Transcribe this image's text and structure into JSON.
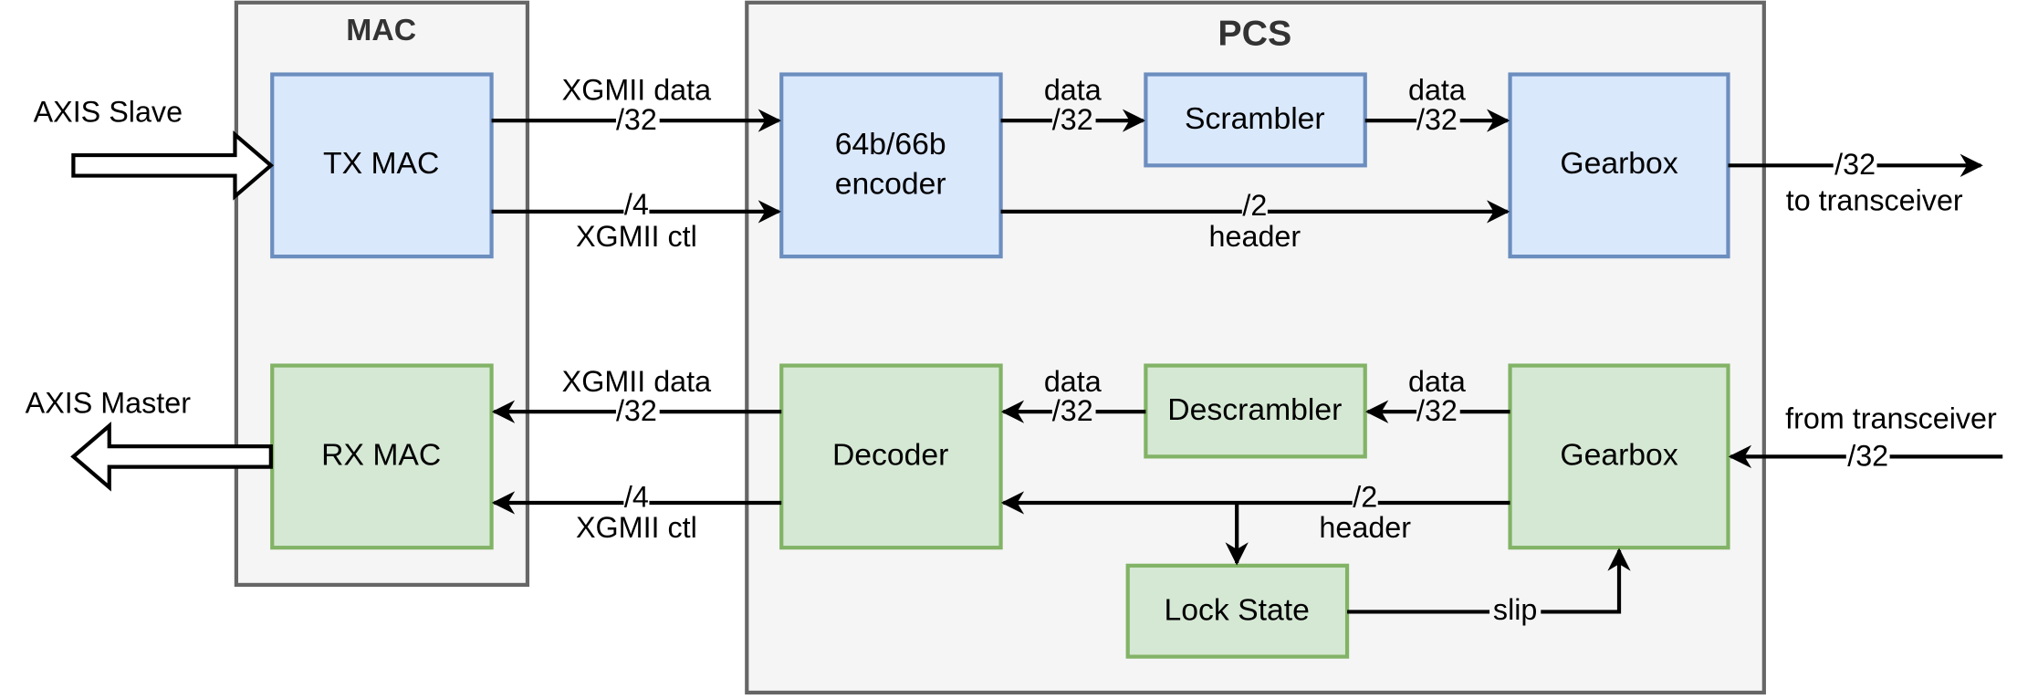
{
  "groups": {
    "mac": "MAC",
    "pcs": "PCS"
  },
  "blocks": {
    "tx_mac": "TX MAC",
    "encoder_l1": "64b/66b",
    "encoder_l2": "encoder",
    "scrambler": "Scrambler",
    "gearbox_tx": "Gearbox",
    "rx_mac": "RX MAC",
    "decoder": "Decoder",
    "descrambler": "Descrambler",
    "gearbox_rx": "Gearbox",
    "lock_state": "Lock State"
  },
  "io": {
    "axis_slave": "AXIS Slave",
    "axis_master": "AXIS Master",
    "to_transceiver": "to transceiver",
    "from_transceiver": "from transceiver"
  },
  "signals": {
    "xgmii_data": "XGMII data",
    "xgmii_ctl": "XGMII ctl",
    "data": "data",
    "header": "header",
    "slip": "slip",
    "w32": "/32",
    "w4": "/4",
    "w2": "/2"
  },
  "colors": {
    "tx_fill": "#dae8fc",
    "tx_stroke": "#6c8ebf",
    "rx_fill": "#d5e8d4",
    "rx_stroke": "#82b366",
    "group_fill": "#f5f5f5",
    "group_stroke": "#666666"
  }
}
